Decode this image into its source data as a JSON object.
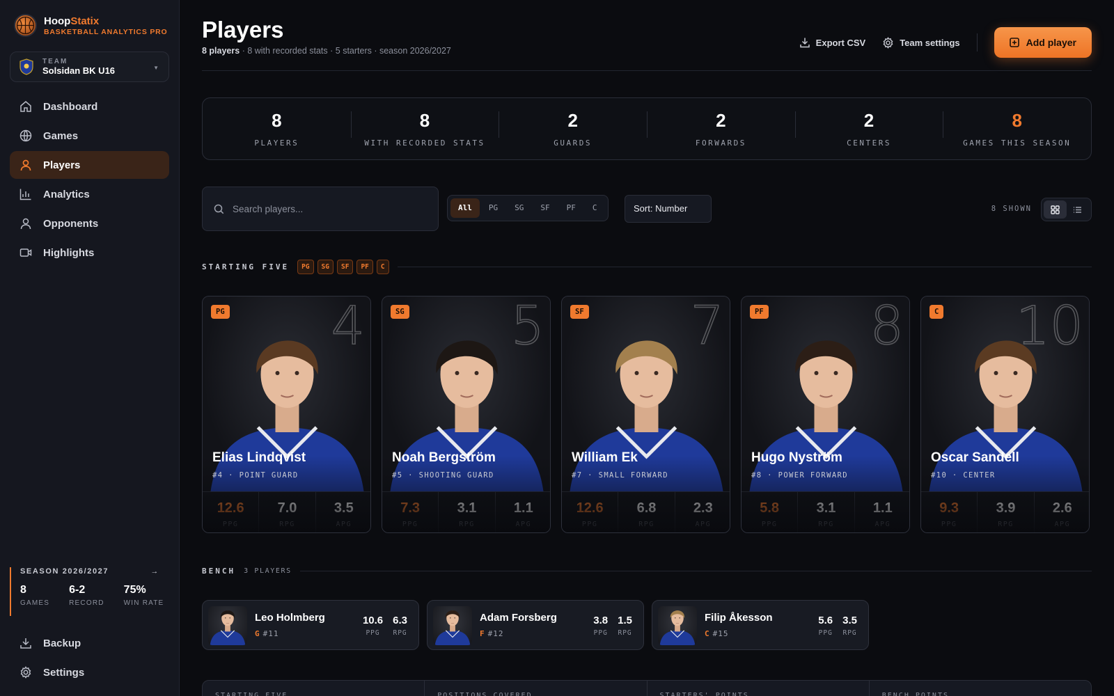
{
  "brand": {
    "name_a": "Hoop",
    "name_b": "Statix",
    "subtitle": "BASKETBALL ANALYTICS PRO"
  },
  "team": {
    "label": "TEAM",
    "name": "Solsidan BK U16"
  },
  "nav": [
    {
      "label": "Dashboard",
      "icon": "home-icon"
    },
    {
      "label": "Games",
      "icon": "globe-icon"
    },
    {
      "label": "Players",
      "icon": "person-icon",
      "active": true
    },
    {
      "label": "Analytics",
      "icon": "bar-chart-icon"
    },
    {
      "label": "Opponents",
      "icon": "person-icon"
    },
    {
      "label": "Highlights",
      "icon": "video-icon"
    }
  ],
  "season": {
    "title": "SEASON 2026/2027",
    "stats": [
      {
        "value": "8",
        "label": "GAMES"
      },
      {
        "value": "6-2",
        "label": "RECORD"
      },
      {
        "value": "75%",
        "label": "WIN RATE"
      }
    ]
  },
  "bottom_nav": [
    {
      "label": "Backup",
      "icon": "download-icon"
    },
    {
      "label": "Settings",
      "icon": "gear-icon"
    }
  ],
  "header": {
    "title": "Players",
    "sub_bold": "8 players",
    "sub_rest": " · 8 with recorded stats · 5 starters · season 2026/2027",
    "export_label": "Export CSV",
    "settings_label": "Team settings",
    "add_label": "Add player"
  },
  "summary_stats": [
    {
      "value": "8",
      "label": "PLAYERS"
    },
    {
      "value": "8",
      "label": "WITH RECORDED STATS"
    },
    {
      "value": "2",
      "label": "GUARDS"
    },
    {
      "value": "2",
      "label": "FORWARDS"
    },
    {
      "value": "2",
      "label": "CENTERS"
    },
    {
      "value": "8",
      "label": "GAMES THIS SEASON",
      "accent": true
    }
  ],
  "toolbar": {
    "search_placeholder": "Search players...",
    "filters": [
      "All",
      "PG",
      "SG",
      "SF",
      "PF",
      "C"
    ],
    "active_filter": "All",
    "sort": "Sort: Number",
    "shown": "8 SHOWN"
  },
  "starting": {
    "title": "STARTING FIVE",
    "chips": [
      "PG",
      "SG",
      "SF",
      "PF",
      "C"
    ],
    "players": [
      {
        "pos": "PG",
        "number": "4",
        "name": "Elias Lindqvist",
        "meta": "#4 · POINT GUARD",
        "ppg": "12.6",
        "rpg": "7.0",
        "apg": "3.5",
        "hair": "#5a3a22"
      },
      {
        "pos": "SG",
        "number": "5",
        "name": "Noah Bergström",
        "meta": "#5 · SHOOTING GUARD",
        "ppg": "7.3",
        "rpg": "3.1",
        "apg": "1.1",
        "hair": "#1d1714"
      },
      {
        "pos": "SF",
        "number": "7",
        "name": "William Ek",
        "meta": "#7 · SMALL FORWARD",
        "ppg": "12.6",
        "rpg": "6.8",
        "apg": "2.3",
        "hair": "#a3804e"
      },
      {
        "pos": "PF",
        "number": "8",
        "name": "Hugo Nyström",
        "meta": "#8 · POWER FORWARD",
        "ppg": "5.8",
        "rpg": "3.1",
        "apg": "1.1",
        "hair": "#2c1e16"
      },
      {
        "pos": "C",
        "number": "10",
        "name": "Oscar Sandell",
        "meta": "#10 · CENTER",
        "ppg": "9.3",
        "rpg": "3.9",
        "apg": "2.6",
        "hair": "#5b3b22"
      }
    ],
    "stat_labels": {
      "ppg": "PPG",
      "rpg": "RPG",
      "apg": "APG"
    }
  },
  "bench": {
    "title": "BENCH",
    "count": "3 PLAYERS",
    "players": [
      {
        "name": "Leo Holmberg",
        "pos": "G",
        "number": "#11",
        "ppg": "10.6",
        "rpg": "6.3",
        "hair": "#1d1714"
      },
      {
        "name": "Adam Forsberg",
        "pos": "F",
        "number": "#12",
        "ppg": "3.8",
        "rpg": "1.5",
        "hair": "#2c1e16"
      },
      {
        "name": "Filip Åkesson",
        "pos": "C",
        "number": "#15",
        "ppg": "5.6",
        "rpg": "3.5",
        "hair": "#a3804e"
      }
    ],
    "stat_labels": {
      "ppg": "PPG",
      "rpg": "RPG"
    }
  },
  "summary_row": [
    "STARTING FIVE",
    "POSITIONS COVERED",
    "STARTERS' POINTS",
    "BENCH POINTS"
  ],
  "colors": {
    "accent": "#f07a2e",
    "background": "#0b0c10",
    "sidebar": "#15171f",
    "jersey": "#1f3a9a"
  }
}
